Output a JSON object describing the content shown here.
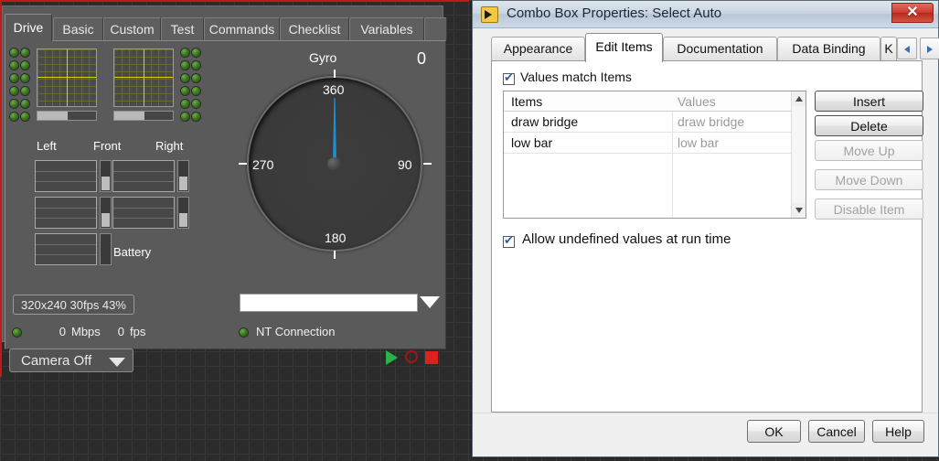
{
  "front_panel": {
    "tabs": [
      {
        "label": "Drive",
        "active": true
      },
      {
        "label": "Basic",
        "active": false
      },
      {
        "label": "Custom",
        "active": false
      },
      {
        "label": "Test",
        "active": false
      },
      {
        "label": "Commands",
        "active": false
      },
      {
        "label": "Checklist",
        "active": false
      },
      {
        "label": "Variables",
        "active": false
      }
    ],
    "direction_labels": [
      "Left",
      "Front",
      "Right"
    ],
    "battery_label": "Battery",
    "gauge": {
      "title": "Gyro",
      "value": "0",
      "tick_top": "360",
      "tick_right": "90",
      "tick_bottom": "180",
      "tick_left": "270",
      "needle_angle_deg": 0,
      "needle_color": "#1f8fd4"
    },
    "camera_pill": "320x240  30fps  43%",
    "bandwidth_value": "0",
    "bandwidth_unit": "Mbps",
    "fps_value": "0",
    "fps_unit": "fps",
    "nt_connection_label": "NT Connection",
    "camera_combo_label": "Camera Off",
    "dropdown_value": ""
  },
  "dialog": {
    "title": "Combo Box Properties: Select Auto",
    "close_glyph": "✕",
    "tabs": [
      {
        "label": "Appearance",
        "active": false
      },
      {
        "label": "Edit Items",
        "active": true
      },
      {
        "label": "Documentation",
        "active": false
      },
      {
        "label": "Data Binding",
        "active": false
      },
      {
        "label": "K",
        "active": false
      }
    ],
    "values_match_items": {
      "label": "Values match Items",
      "checked": true
    },
    "allow_undefined": {
      "label": "Allow undefined values at run time",
      "checked": true
    },
    "list": {
      "columns": [
        "Items",
        "Values"
      ],
      "rows": [
        {
          "item": "draw bridge",
          "value": "draw bridge"
        },
        {
          "item": "low bar",
          "value": "low bar"
        }
      ]
    },
    "side_buttons": [
      {
        "label": "Insert",
        "disabled": false
      },
      {
        "label": "Delete",
        "disabled": false
      },
      {
        "label": "Move Up",
        "disabled": true
      },
      {
        "label": "Move Down",
        "disabled": true
      },
      {
        "label": "Disable Item",
        "disabled": true
      }
    ],
    "footer_buttons": [
      {
        "label": "OK"
      },
      {
        "label": "Cancel"
      },
      {
        "label": "Help"
      }
    ]
  },
  "colors": {
    "accent_blue": "#1f8fd4",
    "led_green": "#3f7a22",
    "stop_red": "#e02020",
    "run_green": "#27b44a",
    "dialog_bg": "#f0f0f0",
    "panel_gray": "#5a5a5a"
  }
}
